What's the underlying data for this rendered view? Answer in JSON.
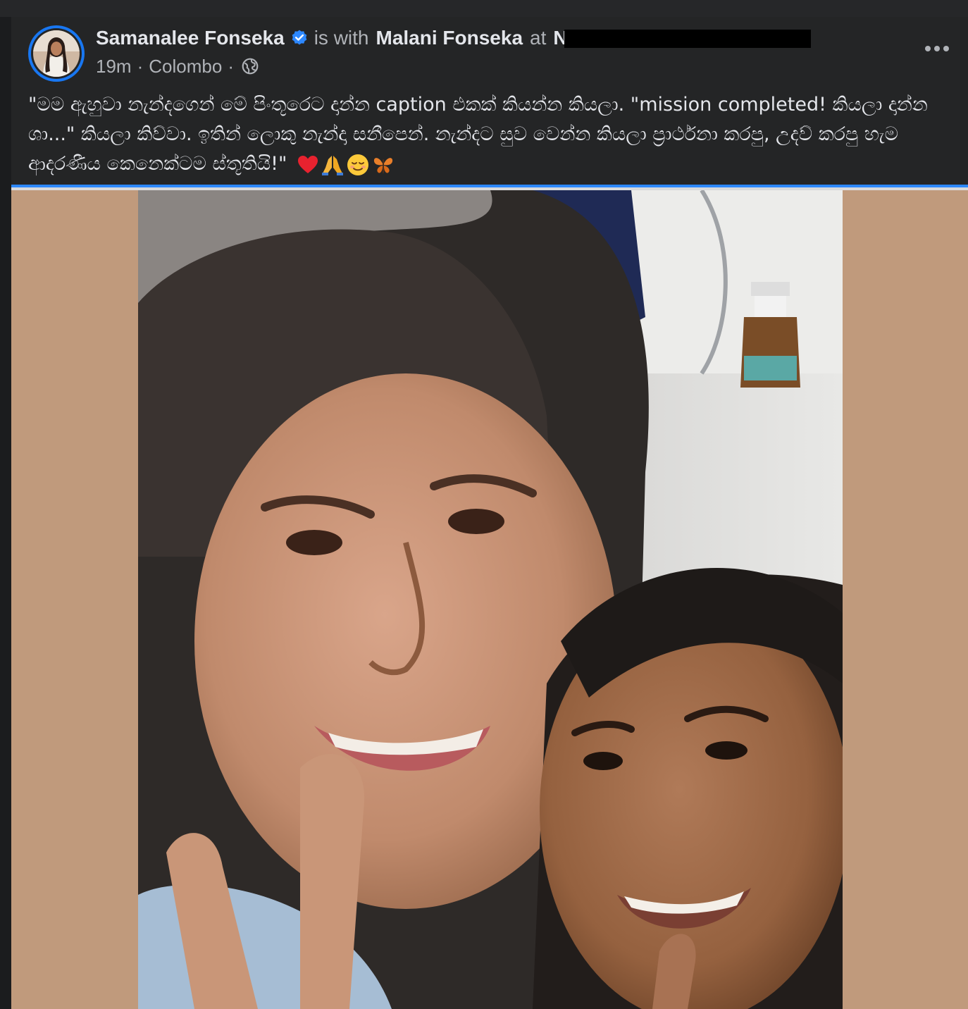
{
  "post": {
    "author": "Samanalee Fonseka",
    "with_text": "is with",
    "tagged": "Malani Fonseka",
    "at_text": "at",
    "place_visible": "N",
    "time": "19m",
    "location": "Colombo",
    "caption": "\"මම ඇහුවා නැන්දගෙන් මේ පිංතූරෙට දාන්න caption එකක් කියන්න කියලා. \"mission completed! කියලා දාන්න ශා...\" කියලා කිව්වා. ඉතින් ලොකු නැන්දා සනීපෙන්. නැන්දට සුව වෙන්න කියලා ප්‍රාර්ථනා කරපු, උදව් කරපු හැම ආදරණීය කෙනෙක්ටම ස්තූතියි!\"",
    "emojis": [
      "heart-emoji",
      "folded-hands-emoji",
      "relieved-face-emoji",
      "butterfly-emoji"
    ],
    "accent_color": "#1877f2",
    "verified_color": "#2d88ff"
  },
  "icons": {
    "verified": "verified-badge-icon",
    "privacy": "globe-icon",
    "more": "more-options-icon"
  }
}
